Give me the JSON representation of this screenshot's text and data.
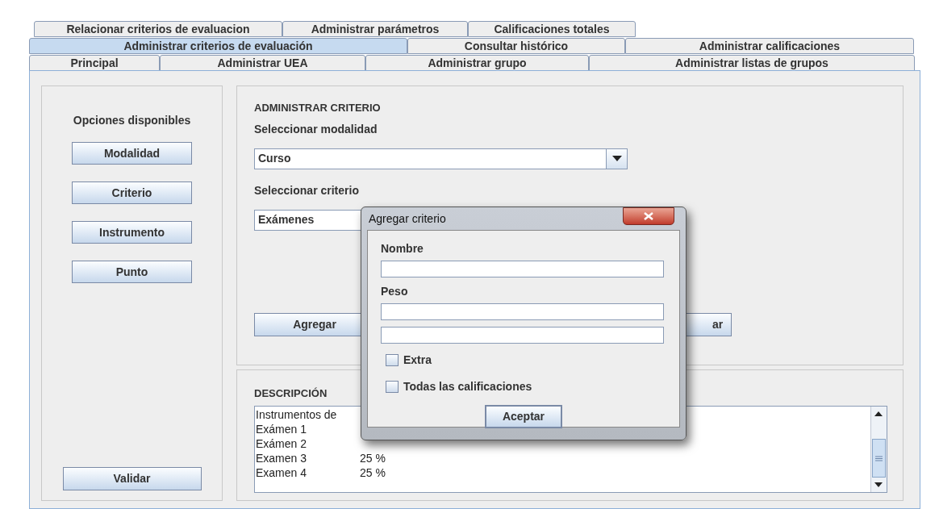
{
  "tab_rows": [
    [
      {
        "label": "Relacionar criterios de evaluacion",
        "selected": false
      },
      {
        "label": "Administrar parámetros",
        "selected": false
      },
      {
        "label": "Calificaciones totales",
        "selected": false
      }
    ],
    [
      {
        "label": "Administrar criterios de evaluación",
        "selected": true
      },
      {
        "label": "Consultar histórico",
        "selected": false
      },
      {
        "label": "Administrar calificaciones",
        "selected": false
      }
    ],
    [
      {
        "label": "Principal",
        "selected": false
      },
      {
        "label": "Administrar UEA",
        "selected": false
      },
      {
        "label": "Administrar grupo",
        "selected": false
      },
      {
        "label": "Administrar listas de grupos",
        "selected": false
      }
    ]
  ],
  "sidebar": {
    "title": "Opciones disponibles",
    "buttons": [
      "Modalidad",
      "Criterio",
      "Instrumento",
      "Punto"
    ],
    "validate_button": "Validar"
  },
  "criterion_panel": {
    "title": "ADMINISTRAR CRITERIO",
    "modality_label": "Seleccionar modalidad",
    "modality_value": "Curso",
    "criterion_label": "Seleccionar criterio",
    "criterion_value": "Exámenes",
    "buttons": [
      "Agregar",
      "ar"
    ]
  },
  "description_panel": {
    "title": "DESCRIPCIÓN",
    "lines": [
      {
        "name": "Instrumentos de"
      },
      {
        "name": "Exámen 1"
      },
      {
        "name": "Exámen 2"
      },
      {
        "name": "Examen 3",
        "value": "25 %"
      },
      {
        "name": "Examen 4",
        "value": "25 %"
      }
    ]
  },
  "dialog": {
    "title": "Agregar criterio",
    "fields": [
      {
        "kind": "text_field",
        "label": "Nombre"
      },
      {
        "kind": "text_field",
        "label": "Peso"
      },
      {
        "kind": "text_field"
      }
    ],
    "checkboxes": [
      {
        "label": "Extra",
        "checked": false
      },
      {
        "label": "Todas las calificaciones",
        "checked": false
      }
    ],
    "button": "Aceptar"
  }
}
